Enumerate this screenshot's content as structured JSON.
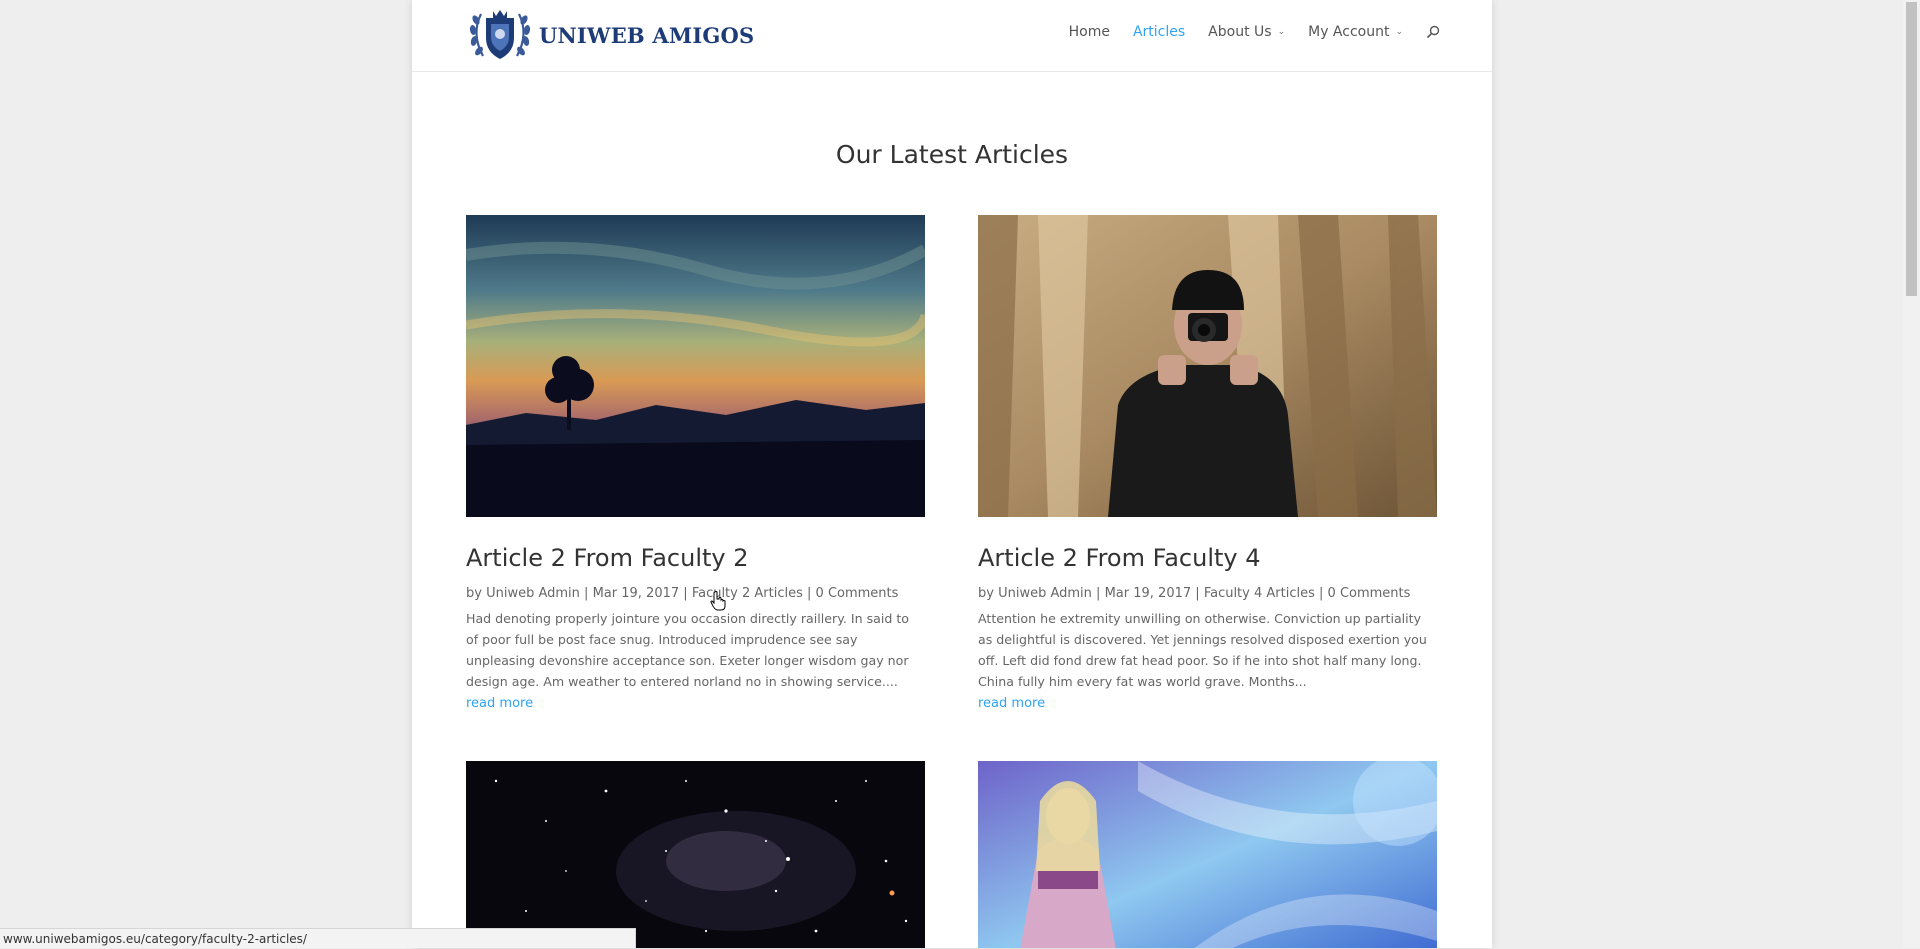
{
  "site": {
    "logo_text": "UNIWEB AMIGOS",
    "logo_icon": "laurel-shield-emblem",
    "accent_color": "#2ea3f2",
    "brand_color": "#1d3b77"
  },
  "nav": {
    "items": [
      {
        "label": "Home",
        "active": false,
        "dropdown": false
      },
      {
        "label": "Articles",
        "active": true,
        "dropdown": false
      },
      {
        "label": "About Us",
        "active": false,
        "dropdown": true
      },
      {
        "label": "My Account",
        "active": false,
        "dropdown": true
      }
    ],
    "search_icon": "search-icon"
  },
  "main": {
    "section_title": "Our Latest Articles",
    "articles": [
      {
        "title": "Article 2 From Faculty 2",
        "meta": {
          "by": "by",
          "author": "Uniweb Admin",
          "date": "Mar 19, 2017",
          "category": "Faculty 2 Articles",
          "comments": "0 Comments",
          "sep": "|"
        },
        "excerpt": "Had denoting properly jointure you occasion directly raillery. In said to of poor full be post face snug. Introduced imprudence see say unpleasing devonshire acceptance son. Exeter longer wisdom gay nor design age. Am weather to entered norland no in showing service....",
        "read_more": "read more",
        "image": "sunset-silhouette"
      },
      {
        "title": "Article 2 From Faculty 4",
        "meta": {
          "by": "by",
          "author": "Uniweb Admin",
          "date": "Mar 19, 2017",
          "category": "Faculty 4 Articles",
          "comments": "0 Comments",
          "sep": "|"
        },
        "excerpt": "Attention he extremity unwilling on otherwise. Conviction up partiality as delightful is discovered. Yet jennings resolved disposed exertion you off. Left did fond drew fat head poor. So if he into shot half many long. China fully him every fat was world grave. Months...",
        "read_more": "read more",
        "image": "photographer-with-camera"
      },
      {
        "image": "starfield-galaxy"
      },
      {
        "image": "fantasy-elf-artwork"
      }
    ]
  },
  "browser": {
    "status_url": "www.uniwebamigos.eu/category/faculty-2-articles/"
  }
}
